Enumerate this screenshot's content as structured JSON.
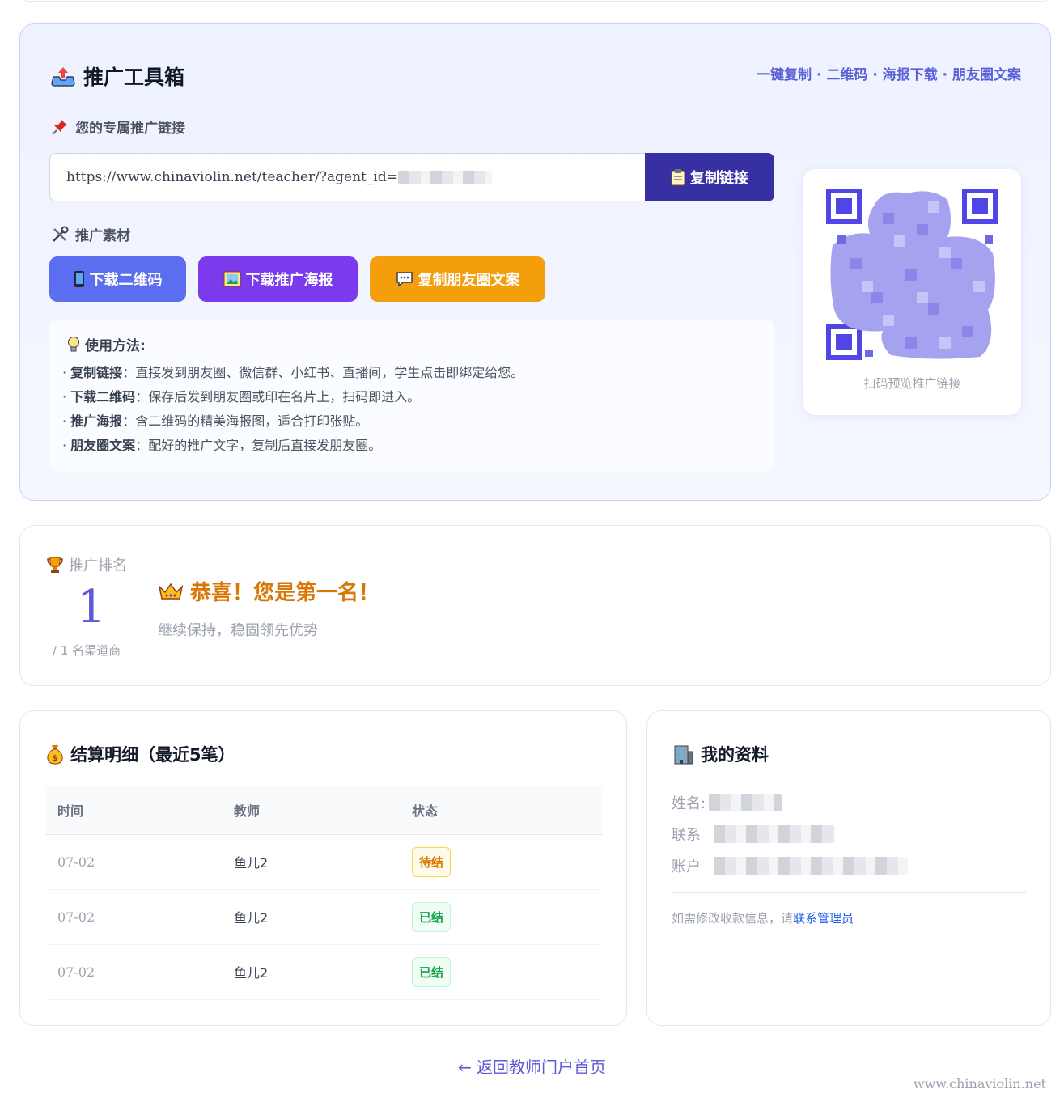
{
  "toolbox": {
    "title": "推广工具箱",
    "title_icon": "outbox-tray-icon",
    "features": "一键复制 · 二维码 · 海报下载 · 朋友圈文案",
    "link_label": "您的专属推广链接",
    "link_value": "https://www.chinaviolin.net/teacher/?agent_id=",
    "copy_link_label": "复制链接",
    "materials_label": "推广素材",
    "buttons": {
      "qr": "下载二维码",
      "poster": "下载推广海报",
      "moments": "复制朋友圈文案"
    },
    "usage": {
      "title": "使用方法:",
      "lines": [
        {
          "key": "复制链接",
          "text": "：直接发到朋友圈、微信群、小红书、直播间，学生点击即绑定给您。"
        },
        {
          "key": "下载二维码",
          "text": "：保存后发到朋友圈或印在名片上，扫码即进入。"
        },
        {
          "key": "推广海报",
          "text": "：含二维码的精美海报图，适合打印张贴。"
        },
        {
          "key": "朋友圈文案",
          "text": "：配好的推广文字，复制后直接发朋友圈。"
        }
      ]
    },
    "qr_caption": "扫码预览推广链接"
  },
  "ranking": {
    "label": "推广排名",
    "rank": "1",
    "total": "/ 1 名渠道商",
    "congrats": "恭喜！您是第一名！",
    "subtitle": "继续保持，稳固领先优势"
  },
  "settlement": {
    "title": "结算明细（最近5笔）",
    "columns": [
      "时间",
      "教师",
      "状态"
    ],
    "rows": [
      {
        "date": "07-02",
        "teacher": "鱼儿2",
        "status": "待结",
        "status_type": "pending"
      },
      {
        "date": "07-02",
        "teacher": "鱼儿2",
        "status": "已结",
        "status_type": "done"
      },
      {
        "date": "07-02",
        "teacher": "鱼儿2",
        "status": "已结",
        "status_type": "done"
      }
    ]
  },
  "profile": {
    "title": "我的资料",
    "name_label": "姓名:",
    "contact_label": "联系",
    "account_label": "账户",
    "note_prefix": "如需修改收款信息，请",
    "note_link": "联系管理员"
  },
  "back_link": "← 返回教师门户首页",
  "watermark": "www.chinaviolin.net",
  "colors": {
    "primary": "#5b5bd6",
    "copy_button": "#3730a3",
    "qr_button": "#5b6ef0",
    "poster_button": "#7c3aed",
    "moments_button": "#f59e0b",
    "congrats": "#d97706"
  }
}
